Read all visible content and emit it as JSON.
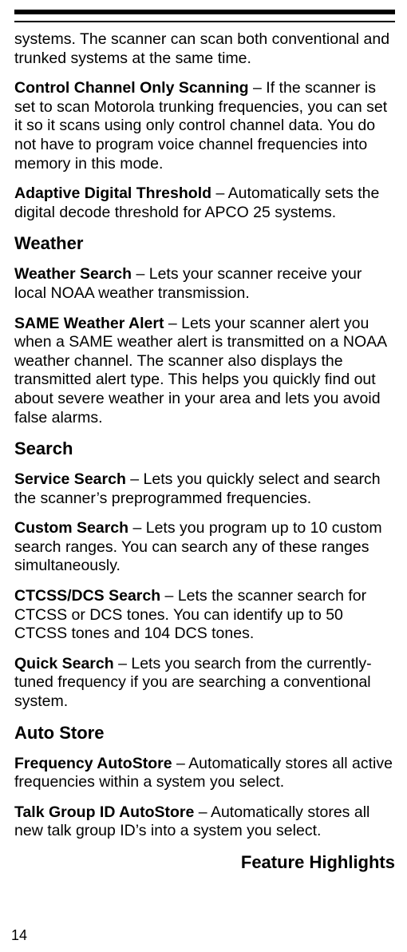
{
  "intro_continuation": "systems. The scanner can scan both conventional and trunked systems at the same time.",
  "features_top": [
    {
      "term": "Control Channel Only Scanning",
      "sep": " – ",
      "desc": "If the scanner is set to scan Motorola trunking frequencies, you can set it so it scans using only control channel data. You do not have to program voice channel frequencies into memory in this mode."
    },
    {
      "term": "Adaptive Digital Threshold",
      "sep": " – ",
      "desc": "Automatically sets the digital decode threshold for APCO 25 systems."
    }
  ],
  "sections": [
    {
      "heading": "Weather",
      "items": [
        {
          "term": "Weather Search",
          "sep": " – ",
          "desc": "Lets your scanner receive your local NOAA weather transmission."
        },
        {
          "term": "SAME Weather Alert",
          "sep": " – ",
          "desc": "Lets your scanner alert you when a SAME weather alert is transmitted on a NOAA weather channel. The scanner also displays the transmitted alert type. This helps you quickly find out about severe weather in your area and lets you avoid false alarms."
        }
      ]
    },
    {
      "heading": "Search",
      "items": [
        {
          "term": "Service Search",
          "sep": " – ",
          "desc": "Lets you quickly select and search the scanner’s preprogrammed frequencies."
        },
        {
          "term": "Custom Search",
          "sep": " – ",
          "desc": "Lets you program up to 10 custom search ranges. You can search any of these ranges simultaneously."
        },
        {
          "term": "CTCSS/DCS Search",
          "sep": " – ",
          "desc": "Lets the scanner search for CTCSS or DCS tones. You can identify up to 50 CTCSS tones and 104 DCS tones."
        },
        {
          "term": "Quick Search",
          "sep": " – ",
          "desc": "Lets you search from the currently-tuned frequency if you are searching a conventional system."
        }
      ]
    },
    {
      "heading": "Auto Store",
      "items": [
        {
          "term": "Frequency AutoStore",
          "sep": " – ",
          "desc": "Automatically stores all active frequencies within a system you select."
        },
        {
          "term": "Talk Group ID AutoStore",
          "sep": " – ",
          "desc": "Automatically stores all new talk group ID’s into a system you select."
        }
      ]
    }
  ],
  "footer_title": "Feature Highlights",
  "page_number": "14"
}
